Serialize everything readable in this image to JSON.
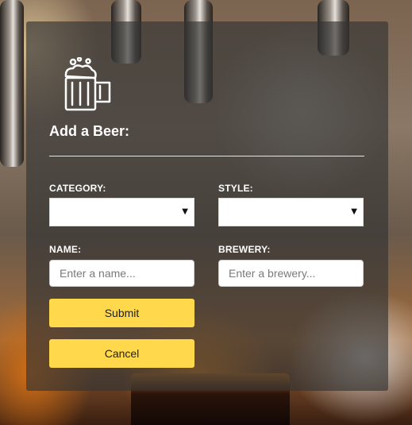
{
  "form": {
    "title": "Add a Beer:",
    "logo_icon": "beer-mug-icon",
    "category_label": "CATEGORY:",
    "style_label": "STYLE:",
    "name_label": "NAME:",
    "brewery_label": "BREWERY:",
    "category_value": "",
    "style_value": "",
    "name_placeholder": "Enter a name...",
    "brewery_placeholder": "Enter a brewery...",
    "caret_icon": "▼",
    "submit_label": "Submit",
    "cancel_label": "Cancel"
  },
  "colors": {
    "button": "#ffd84c",
    "panel": "rgba(52,52,52,0.66)",
    "text": "#ffffff"
  }
}
